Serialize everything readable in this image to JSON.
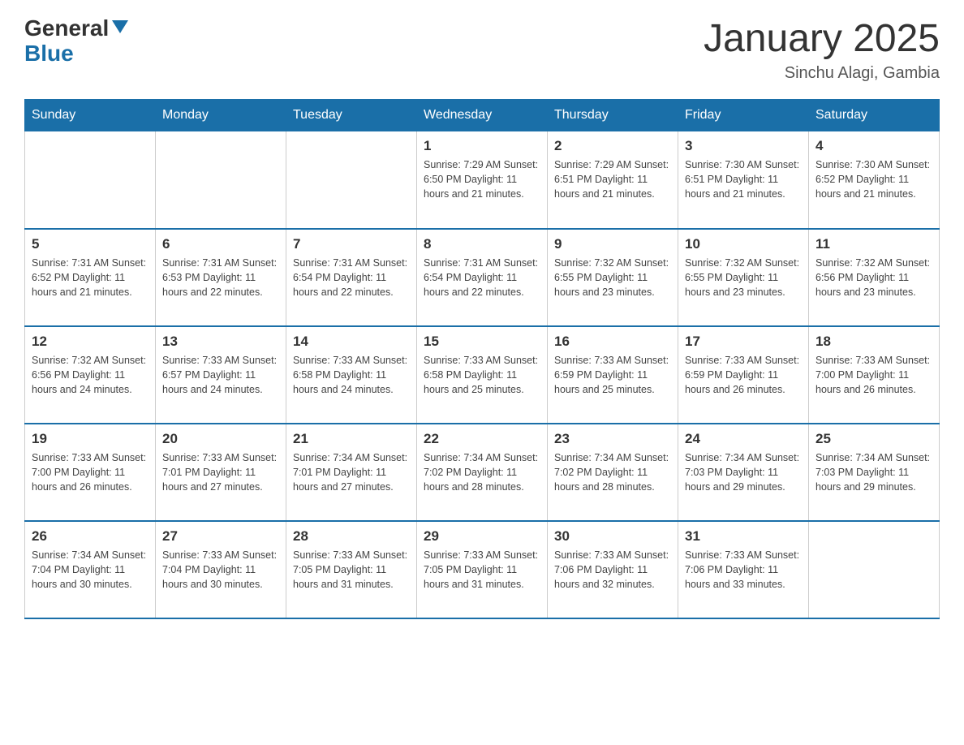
{
  "header": {
    "logo": {
      "general": "General",
      "arrow": "▲",
      "blue": "Blue"
    },
    "title": "January 2025",
    "subtitle": "Sinchu Alagi, Gambia"
  },
  "days_of_week": [
    "Sunday",
    "Monday",
    "Tuesday",
    "Wednesday",
    "Thursday",
    "Friday",
    "Saturday"
  ],
  "weeks": [
    [
      {
        "day": "",
        "info": ""
      },
      {
        "day": "",
        "info": ""
      },
      {
        "day": "",
        "info": ""
      },
      {
        "day": "1",
        "info": "Sunrise: 7:29 AM\nSunset: 6:50 PM\nDaylight: 11 hours and 21 minutes."
      },
      {
        "day": "2",
        "info": "Sunrise: 7:29 AM\nSunset: 6:51 PM\nDaylight: 11 hours and 21 minutes."
      },
      {
        "day": "3",
        "info": "Sunrise: 7:30 AM\nSunset: 6:51 PM\nDaylight: 11 hours and 21 minutes."
      },
      {
        "day": "4",
        "info": "Sunrise: 7:30 AM\nSunset: 6:52 PM\nDaylight: 11 hours and 21 minutes."
      }
    ],
    [
      {
        "day": "5",
        "info": "Sunrise: 7:31 AM\nSunset: 6:52 PM\nDaylight: 11 hours and 21 minutes."
      },
      {
        "day": "6",
        "info": "Sunrise: 7:31 AM\nSunset: 6:53 PM\nDaylight: 11 hours and 22 minutes."
      },
      {
        "day": "7",
        "info": "Sunrise: 7:31 AM\nSunset: 6:54 PM\nDaylight: 11 hours and 22 minutes."
      },
      {
        "day": "8",
        "info": "Sunrise: 7:31 AM\nSunset: 6:54 PM\nDaylight: 11 hours and 22 minutes."
      },
      {
        "day": "9",
        "info": "Sunrise: 7:32 AM\nSunset: 6:55 PM\nDaylight: 11 hours and 23 minutes."
      },
      {
        "day": "10",
        "info": "Sunrise: 7:32 AM\nSunset: 6:55 PM\nDaylight: 11 hours and 23 minutes."
      },
      {
        "day": "11",
        "info": "Sunrise: 7:32 AM\nSunset: 6:56 PM\nDaylight: 11 hours and 23 minutes."
      }
    ],
    [
      {
        "day": "12",
        "info": "Sunrise: 7:32 AM\nSunset: 6:56 PM\nDaylight: 11 hours and 24 minutes."
      },
      {
        "day": "13",
        "info": "Sunrise: 7:33 AM\nSunset: 6:57 PM\nDaylight: 11 hours and 24 minutes."
      },
      {
        "day": "14",
        "info": "Sunrise: 7:33 AM\nSunset: 6:58 PM\nDaylight: 11 hours and 24 minutes."
      },
      {
        "day": "15",
        "info": "Sunrise: 7:33 AM\nSunset: 6:58 PM\nDaylight: 11 hours and 25 minutes."
      },
      {
        "day": "16",
        "info": "Sunrise: 7:33 AM\nSunset: 6:59 PM\nDaylight: 11 hours and 25 minutes."
      },
      {
        "day": "17",
        "info": "Sunrise: 7:33 AM\nSunset: 6:59 PM\nDaylight: 11 hours and 26 minutes."
      },
      {
        "day": "18",
        "info": "Sunrise: 7:33 AM\nSunset: 7:00 PM\nDaylight: 11 hours and 26 minutes."
      }
    ],
    [
      {
        "day": "19",
        "info": "Sunrise: 7:33 AM\nSunset: 7:00 PM\nDaylight: 11 hours and 26 minutes."
      },
      {
        "day": "20",
        "info": "Sunrise: 7:33 AM\nSunset: 7:01 PM\nDaylight: 11 hours and 27 minutes."
      },
      {
        "day": "21",
        "info": "Sunrise: 7:34 AM\nSunset: 7:01 PM\nDaylight: 11 hours and 27 minutes."
      },
      {
        "day": "22",
        "info": "Sunrise: 7:34 AM\nSunset: 7:02 PM\nDaylight: 11 hours and 28 minutes."
      },
      {
        "day": "23",
        "info": "Sunrise: 7:34 AM\nSunset: 7:02 PM\nDaylight: 11 hours and 28 minutes."
      },
      {
        "day": "24",
        "info": "Sunrise: 7:34 AM\nSunset: 7:03 PM\nDaylight: 11 hours and 29 minutes."
      },
      {
        "day": "25",
        "info": "Sunrise: 7:34 AM\nSunset: 7:03 PM\nDaylight: 11 hours and 29 minutes."
      }
    ],
    [
      {
        "day": "26",
        "info": "Sunrise: 7:34 AM\nSunset: 7:04 PM\nDaylight: 11 hours and 30 minutes."
      },
      {
        "day": "27",
        "info": "Sunrise: 7:33 AM\nSunset: 7:04 PM\nDaylight: 11 hours and 30 minutes."
      },
      {
        "day": "28",
        "info": "Sunrise: 7:33 AM\nSunset: 7:05 PM\nDaylight: 11 hours and 31 minutes."
      },
      {
        "day": "29",
        "info": "Sunrise: 7:33 AM\nSunset: 7:05 PM\nDaylight: 11 hours and 31 minutes."
      },
      {
        "day": "30",
        "info": "Sunrise: 7:33 AM\nSunset: 7:06 PM\nDaylight: 11 hours and 32 minutes."
      },
      {
        "day": "31",
        "info": "Sunrise: 7:33 AM\nSunset: 7:06 PM\nDaylight: 11 hours and 33 minutes."
      },
      {
        "day": "",
        "info": ""
      }
    ]
  ]
}
